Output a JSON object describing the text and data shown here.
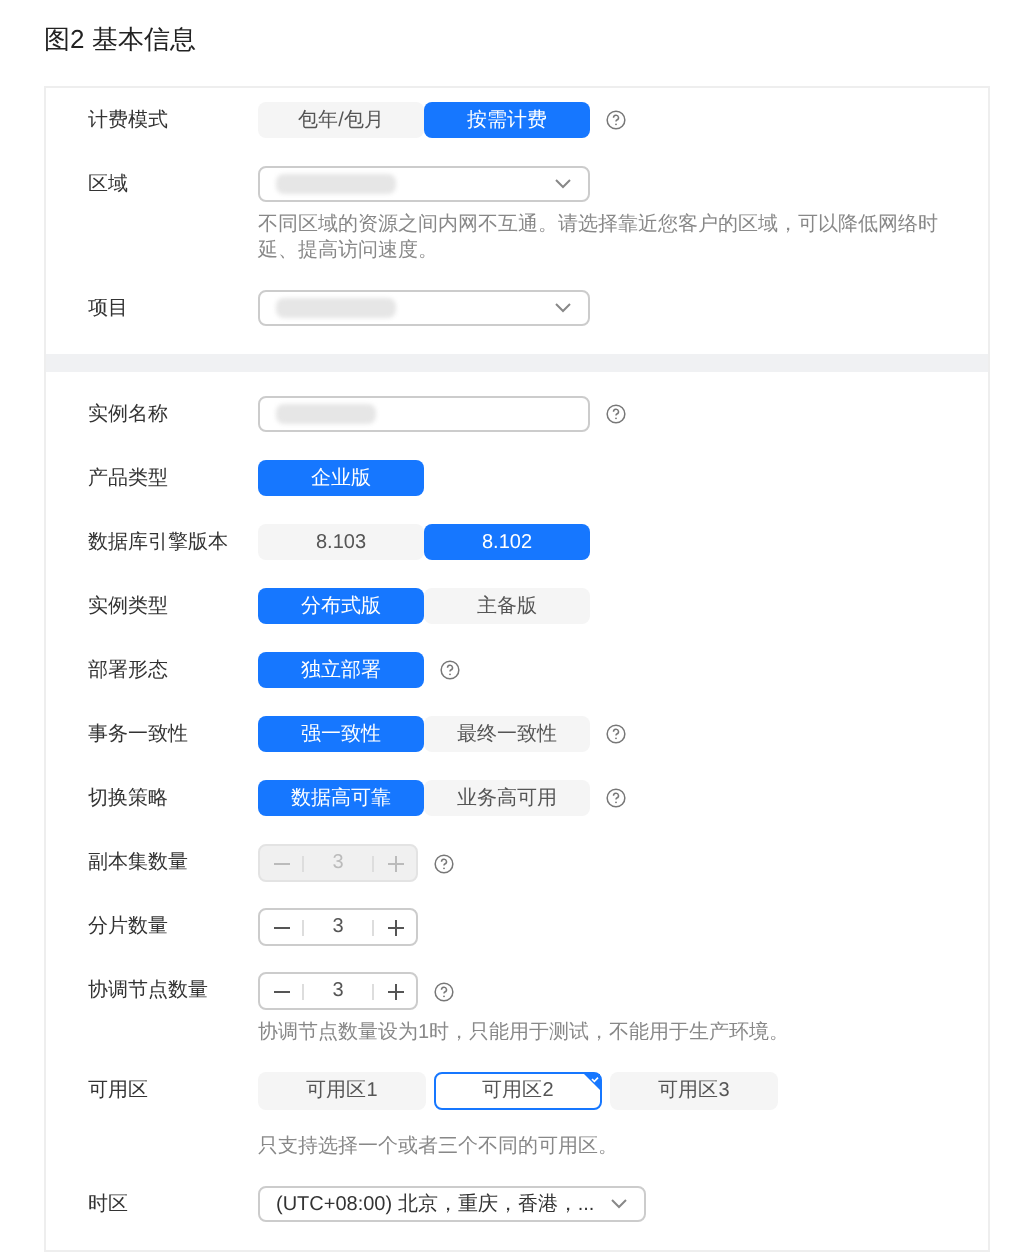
{
  "title": "图2 基本信息",
  "sections": [
    {
      "rows": [
        {
          "label": "计费模式",
          "kind": "segmented",
          "help": true,
          "options": [
            {
              "label": "包年/包月",
              "selected": false
            },
            {
              "label": "按需计费",
              "selected": true
            }
          ]
        },
        {
          "label": "区域",
          "kind": "select",
          "redacted": true,
          "hint": "不同区域的资源之间内网不互通。请选择靠近您客户的区域，可以降低网络时延、提高访问速度。"
        },
        {
          "label": "项目",
          "kind": "select",
          "redacted": true
        }
      ]
    },
    {
      "rows": [
        {
          "label": "实例名称",
          "kind": "input",
          "redacted": true,
          "help": true
        },
        {
          "label": "产品类型",
          "kind": "segmented",
          "options": [
            {
              "label": "企业版",
              "selected": true
            }
          ]
        },
        {
          "label": "数据库引擎版本",
          "kind": "segmented",
          "options": [
            {
              "label": "8.103",
              "selected": false
            },
            {
              "label": "8.102",
              "selected": true
            }
          ]
        },
        {
          "label": "实例类型",
          "kind": "segmented",
          "options": [
            {
              "label": "分布式版",
              "selected": true
            },
            {
              "label": "主备版",
              "selected": false
            }
          ]
        },
        {
          "label": "部署形态",
          "kind": "segmented",
          "help": true,
          "options": [
            {
              "label": "独立部署",
              "selected": true
            }
          ]
        },
        {
          "label": "事务一致性",
          "kind": "segmented",
          "help": true,
          "options": [
            {
              "label": "强一致性",
              "selected": true
            },
            {
              "label": "最终一致性",
              "selected": false
            }
          ]
        },
        {
          "label": "切换策略",
          "kind": "segmented",
          "help": true,
          "options": [
            {
              "label": "数据高可靠",
              "selected": true
            },
            {
              "label": "业务高可用",
              "selected": false
            }
          ]
        },
        {
          "label": "副本集数量",
          "kind": "stepper",
          "value": "3",
          "disabled": true,
          "help": true
        },
        {
          "label": "分片数量",
          "kind": "stepper",
          "value": "3",
          "disabled": false
        },
        {
          "label": "协调节点数量",
          "kind": "stepper",
          "value": "3",
          "disabled": false,
          "help": true,
          "hint": "协调节点数量设为1时，只能用于测试，不能用于生产环境。"
        },
        {
          "label": "可用区",
          "kind": "cards",
          "options": [
            {
              "label": "可用区1",
              "selected": false
            },
            {
              "label": "可用区2",
              "selected": true
            },
            {
              "label": "可用区3",
              "selected": false
            }
          ],
          "hint": "只支持选择一个或者三个不同的可用区。"
        },
        {
          "label": "时区",
          "kind": "select",
          "value": "(UTC+08:00) 北京，重庆，香港，..."
        }
      ]
    }
  ]
}
